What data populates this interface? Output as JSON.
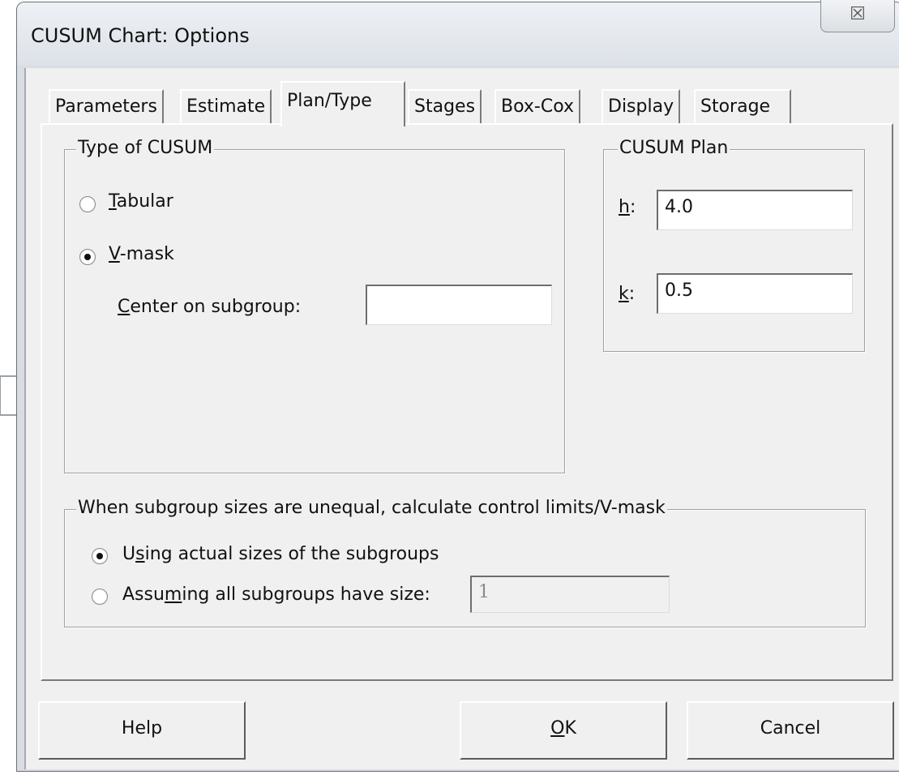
{
  "window": {
    "title": "CUSUM Chart: Options",
    "close_glyph": "☒"
  },
  "tabs": [
    {
      "label": "Parameters",
      "selected": false
    },
    {
      "label": "Estimate",
      "selected": false
    },
    {
      "label": "Plan/Type",
      "selected": true
    },
    {
      "label": "Stages",
      "selected": false
    },
    {
      "label": "Box-Cox",
      "selected": false
    },
    {
      "label": "Display",
      "selected": false
    },
    {
      "label": "Storage",
      "selected": false
    }
  ],
  "type_group": {
    "legend": "Type of CUSUM",
    "tabular": {
      "mnemonic": "T",
      "rest": "abular",
      "checked": false
    },
    "vmask": {
      "mnemonic": "V",
      "rest": "-mask",
      "checked": true
    },
    "center": {
      "mnemonic": "C",
      "rest": "enter on subgroup:",
      "value": ""
    }
  },
  "plan_group": {
    "legend": "CUSUM Plan",
    "h": {
      "mnemonic": "h",
      "rest": ":",
      "value": "4.0"
    },
    "k": {
      "mnemonic": "k",
      "rest": ":",
      "value": "0.5"
    }
  },
  "unequal_group": {
    "legend": "When subgroup sizes are unequal, calculate control limits/V-mask",
    "actual": {
      "pre": "U",
      "mnemonic": "s",
      "rest": "ing actual sizes of the subgroups",
      "checked": true
    },
    "assume": {
      "pre": "Assu",
      "mnemonic": "m",
      "rest": "ing all subgroups have size:",
      "checked": false,
      "value": "1"
    }
  },
  "buttons": {
    "help": "Help",
    "ok": {
      "mnemonic": "O",
      "rest": "K"
    },
    "cancel": "Cancel"
  },
  "icons": {
    "pointer": "right-arrow-icon"
  }
}
